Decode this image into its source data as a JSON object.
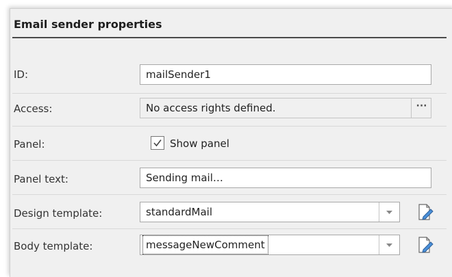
{
  "section": {
    "title": "Email sender properties"
  },
  "id_row": {
    "label": "ID:",
    "value": "mailSender1"
  },
  "access_row": {
    "label": "Access:",
    "value": "No access rights defined.",
    "button": "···"
  },
  "panel_row": {
    "label": "Panel:",
    "checkbox_label": "Show panel",
    "checked": true
  },
  "panel_text_row": {
    "label": "Panel text:",
    "value": "Sending mail…"
  },
  "design_row": {
    "label": "Design template:",
    "value": "standardMail",
    "icon": "edit-template-icon"
  },
  "body_row": {
    "label": "Body template:",
    "value": "messageNewComment",
    "icon": "edit-template-icon"
  }
}
